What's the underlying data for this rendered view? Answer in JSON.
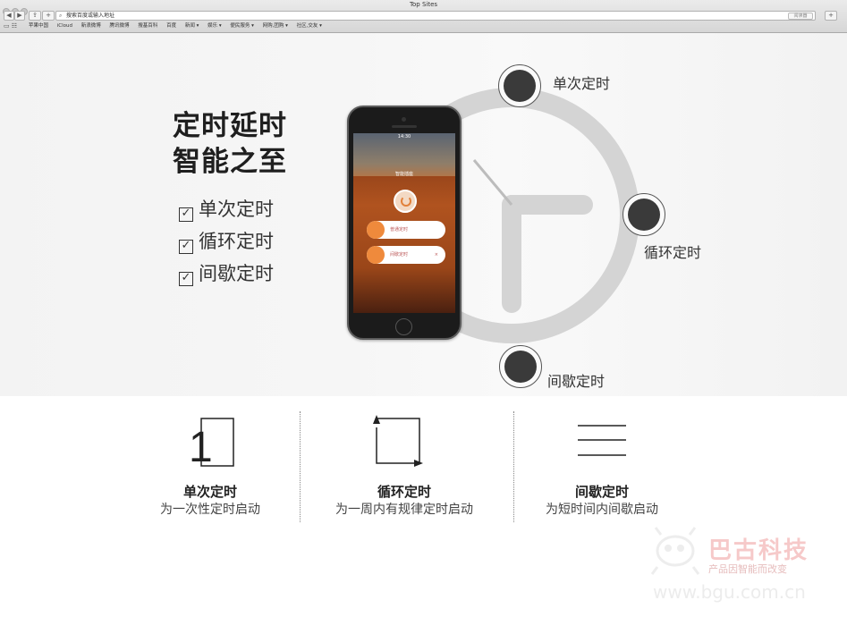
{
  "browser": {
    "window_title": "Top Sites",
    "url_placeholder": "搜索百度或输入地址",
    "reader_label": "阅读器",
    "bookmarks": [
      "苹果中国",
      "iCloud",
      "新浪微博",
      "腾讯微博",
      "搜基百科",
      "百度",
      "新闻 ▾",
      "娱乐 ▾",
      "便民服务 ▾",
      "网购,团购 ▾",
      "社区,交友 ▾"
    ]
  },
  "hero": {
    "headline_line1": "定时延时",
    "headline_line2": "智能之至",
    "check_items": [
      "单次定时",
      "循环定时",
      "间歇定时"
    ],
    "dial_labels": {
      "single": "单次定时",
      "cycle": "循环定时",
      "interval": "间歇定时"
    },
    "phone": {
      "status_time": "14:30",
      "screen_title": "智能插座",
      "pill1": "普通定时",
      "pill2": "间歇定时",
      "pill2_close": "×"
    }
  },
  "features": [
    {
      "icon_text": "1",
      "title": "单次定时",
      "desc": "为一次性定时启动"
    },
    {
      "title": "循环定时",
      "desc": "为一周内有规律定时启动"
    },
    {
      "title": "间歇定时",
      "desc": "为短时间内间歇启动"
    }
  ],
  "watermark": {
    "brand": "巴古科技",
    "slogan": "产品因智能而改变",
    "url": "www.bgu.com.cn"
  },
  "colors": {
    "accent_orange": "#ef8a3c",
    "dark_dot": "#3a3a3a",
    "clock_gray": "#d4d4d4"
  }
}
